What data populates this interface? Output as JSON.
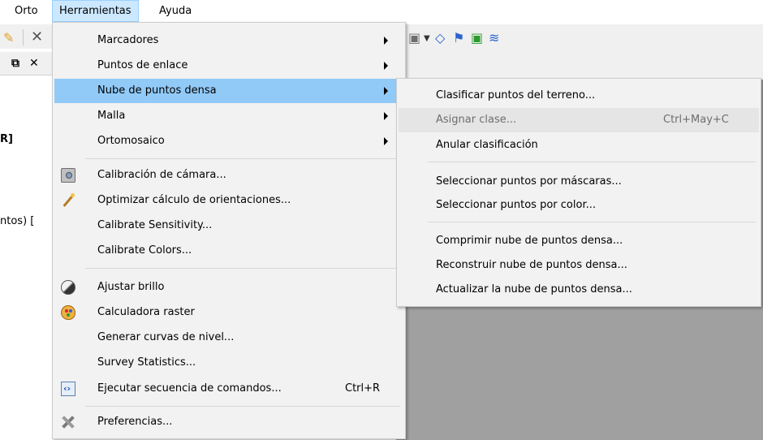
{
  "menubar": {
    "items": [
      {
        "label": "Orto"
      },
      {
        "label": "Herramientas"
      },
      {
        "label": "Ayuda"
      }
    ]
  },
  "side": {
    "bracket_r": "R]",
    "ntos": "ntos) ["
  },
  "tools_menu": {
    "items": [
      {
        "label": "Marcadores",
        "submenu": true
      },
      {
        "label": "Puntos de enlace",
        "submenu": true
      },
      {
        "label": "Nube de puntos densa",
        "submenu": true,
        "highlighted": true
      },
      {
        "label": "Malla",
        "submenu": true
      },
      {
        "label": "Ortomosaico",
        "submenu": true
      },
      {
        "label": "Calibración de cámara...",
        "icon": "camera-icon"
      },
      {
        "label": "Optimizar cálculo de orientaciones...",
        "icon": "wand-icon"
      },
      {
        "label": "Calibrate Sensitivity..."
      },
      {
        "label": "Calibrate Colors..."
      },
      {
        "label": "Ajustar brillo",
        "icon": "brightness-icon"
      },
      {
        "label": "Calculadora raster",
        "icon": "palette-icon"
      },
      {
        "label": "Generar curvas de nivel..."
      },
      {
        "label": "Survey Statistics..."
      },
      {
        "label": "Ejecutar secuencia de comandos...",
        "icon": "script-icon",
        "shortcut": "Ctrl+R"
      },
      {
        "label": "Preferencias...",
        "icon": "tools-icon"
      }
    ]
  },
  "dense_cloud_submenu": {
    "items": [
      {
        "label": "Clasificar puntos del terreno..."
      },
      {
        "label": "Asignar clase...",
        "shortcut": "Ctrl+May+C",
        "disabled": true
      },
      {
        "label": "Anular clasificación"
      },
      {
        "label": "Seleccionar puntos por máscaras..."
      },
      {
        "label": "Seleccionar puntos por color..."
      },
      {
        "label": "Comprimir nube de puntos densa..."
      },
      {
        "label": "Reconstruir nube de puntos densa..."
      },
      {
        "label": "Actualizar la nube de puntos densa..."
      }
    ]
  },
  "colors": {
    "highlight": "#91c9f7",
    "menu_bg": "#f2f2f2",
    "workspace": "#a0a0a0"
  }
}
